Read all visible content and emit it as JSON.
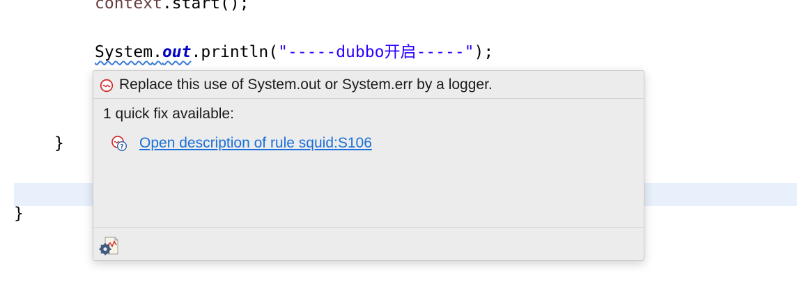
{
  "editor": {
    "line1": {
      "context": "context",
      "rest": ".start();"
    },
    "line2": {
      "system": "System",
      "dot1": ".",
      "out": "out",
      "println": ".println(",
      "string": "\"-----dubbo开启-----\"",
      "end": ");"
    },
    "brace_inner": "}",
    "brace_outer": "}"
  },
  "popup": {
    "message": "Replace this use of System.out or System.err by a logger.",
    "fix_count": "1 quick fix available:",
    "fix_link": "Open description of rule squid:S106",
    "issue_icon": "sonar-issue-icon",
    "fix_icon": "sonar-rule-description-icon",
    "footer_icon": "sonarlint-settings-icon"
  },
  "colors": {
    "popup_bg": "#ececec",
    "link": "#1a6fd8",
    "issue_red": "#d0302f",
    "current_line": "#e8f0fb"
  }
}
